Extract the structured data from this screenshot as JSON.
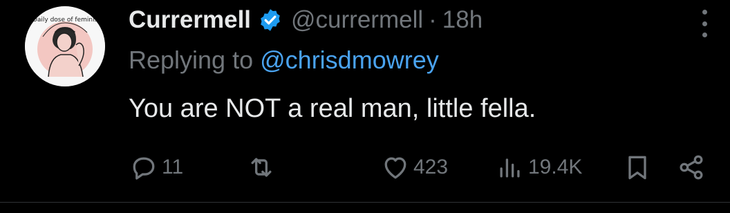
{
  "tweet": {
    "display_name": "Currermell",
    "handle": "@currermell",
    "separator": "·",
    "time": "18h",
    "replying_prefix": "Replying to",
    "replying_to": "@chrisdmowrey",
    "text": "You are NOT a real man, little fella.",
    "avatar_caption": "A Daily dose of feminism"
  },
  "actions": {
    "replies": "11",
    "retweets": "",
    "likes": "423",
    "views": "19.4K"
  },
  "icons": {
    "verified": "verified-badge-icon",
    "more": "more-vertical-icon",
    "reply": "reply-icon",
    "retweet": "retweet-icon",
    "like": "heart-icon",
    "views": "views-chart-icon",
    "bookmark": "bookmark-icon",
    "share": "share-icon"
  },
  "colors": {
    "background": "#000000",
    "text_primary": "#e7e9ea",
    "text_secondary": "#71767b",
    "accent": "#1d9bf0",
    "mention": "#4aa3f0",
    "divider": "#2f3336"
  }
}
